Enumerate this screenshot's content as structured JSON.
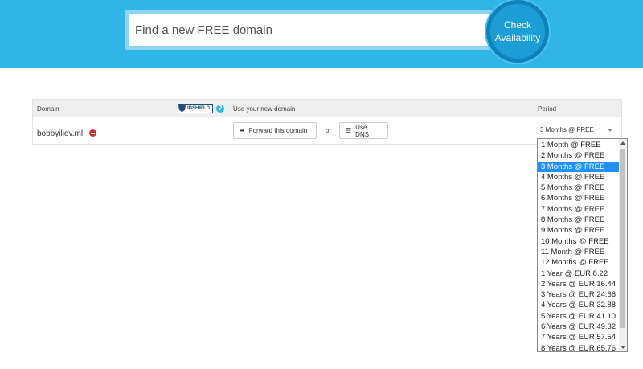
{
  "search": {
    "placeholder": "Find a new FREE domain",
    "button_line1": "Check",
    "button_line2": "Availability"
  },
  "table": {
    "headers": {
      "domain": "Domain",
      "idshield": "IDSHIELD",
      "use": "Use your new domain",
      "period": "Period"
    },
    "row": {
      "domain": "bobbyiliev.ml",
      "forward_label": "Forward this domain",
      "or_label": "or",
      "dns_label": "Use DNS",
      "period_selected": "3 Months @ FREE"
    }
  },
  "dropdown": {
    "selected_index": 2,
    "options": [
      "1 Month @ FREE",
      "2 Months @ FREE",
      "3 Months @ FREE",
      "4 Months @ FREE",
      "5 Months @ FREE",
      "6 Months @ FREE",
      "7 Months @ FREE",
      "8 Months @ FREE",
      "9 Months @ FREE",
      "10 Months @ FREE",
      "11 Month @ FREE",
      "12 Months @ FREE",
      "1 Year @ EUR 8.22",
      "2 Years @ EUR 16.44",
      "3 Years @ EUR 24.66",
      "4 Years @ EUR 32.88",
      "5 Years @ EUR 41.10",
      "6 Years @ EUR 49.32",
      "7 Years @ EUR 57.54",
      "8 Years @ EUR 65.76"
    ]
  },
  "colors": {
    "header_blue": "#2fb5e7",
    "button_blue": "#1b9dd6",
    "selected_option": "#1e90ff",
    "remove_red": "#c9302c"
  }
}
